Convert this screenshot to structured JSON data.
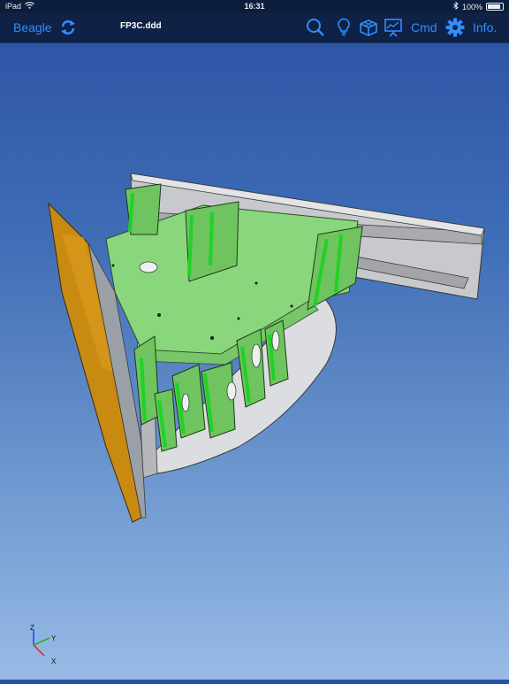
{
  "status": {
    "device": "iPad",
    "time": "16:31",
    "battery": "100%"
  },
  "toolbar": {
    "back_label": "Beagle",
    "file_name": "FP3C.ddd",
    "cmd_label": "Cmd",
    "info_label": "Info."
  },
  "icons": [
    "sync-icon",
    "search-icon",
    "lightbulb-icon",
    "cube-icon",
    "presentation-icon",
    "gear-icon"
  ],
  "axes": {
    "z": "Z",
    "y": "Y",
    "x": "X"
  },
  "colors": {
    "accent": "#2f8fff",
    "toolbar": "#0f2145",
    "model_green": "#7ed46f",
    "model_gray": "#c9cbcf",
    "model_orange": "#c8880e"
  }
}
